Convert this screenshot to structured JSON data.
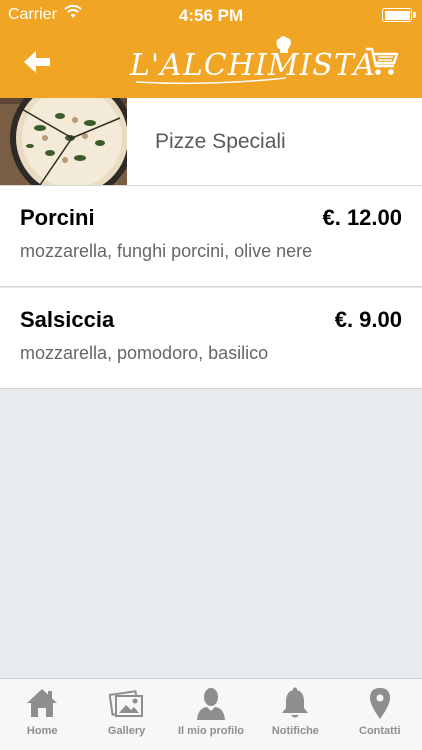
{
  "status_bar": {
    "carrier": "Carrier",
    "time": "4:56 PM"
  },
  "header": {
    "logo_text": "L'ALCHIMISTA",
    "back_icon": "back-arrow-icon",
    "cart_icon": "cart-icon",
    "accent_color": "#f0a524"
  },
  "category": {
    "title": "Pizze Speciali"
  },
  "items": [
    {
      "name": "Porcini",
      "price": "€. 12.00",
      "description": "mozzarella, funghi porcini, olive nere"
    },
    {
      "name": "Salsiccia",
      "price": "€. 9.00",
      "description": "mozzarella, pomodoro, basilico"
    }
  ],
  "tabs": [
    {
      "label": "Home",
      "icon": "home-icon"
    },
    {
      "label": "Gallery",
      "icon": "gallery-icon"
    },
    {
      "label": "Il mio profilo",
      "icon": "profile-icon"
    },
    {
      "label": "Notifiche",
      "icon": "bell-icon"
    },
    {
      "label": "Contatti",
      "icon": "location-pin-icon"
    }
  ]
}
